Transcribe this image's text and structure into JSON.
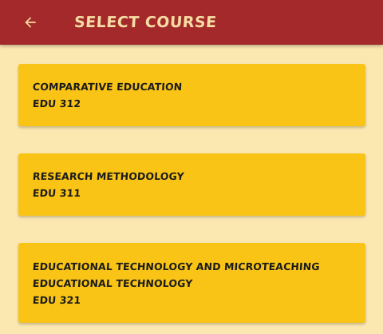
{
  "header": {
    "title": "SELECT COURSE",
    "back_icon": "arrow-left-icon"
  },
  "courses": [
    {
      "lines": [
        "COMPARATIVE EDUCATION",
        "EDU 312"
      ]
    },
    {
      "lines": [
        "RESEARCH METHODOLOGY",
        "EDU 311"
      ]
    },
    {
      "lines": [
        "EDUCATIONAL TECHNOLOGY AND MICROTEACHING",
        "EDUCATIONAL TECHNOLOGY",
        "EDU 321"
      ]
    }
  ],
  "colors": {
    "app_bar": "#a3292b",
    "title_text": "#f7dca3",
    "background": "#fbe7b0",
    "card": "#f9c415",
    "card_text": "#1b1b1b"
  }
}
